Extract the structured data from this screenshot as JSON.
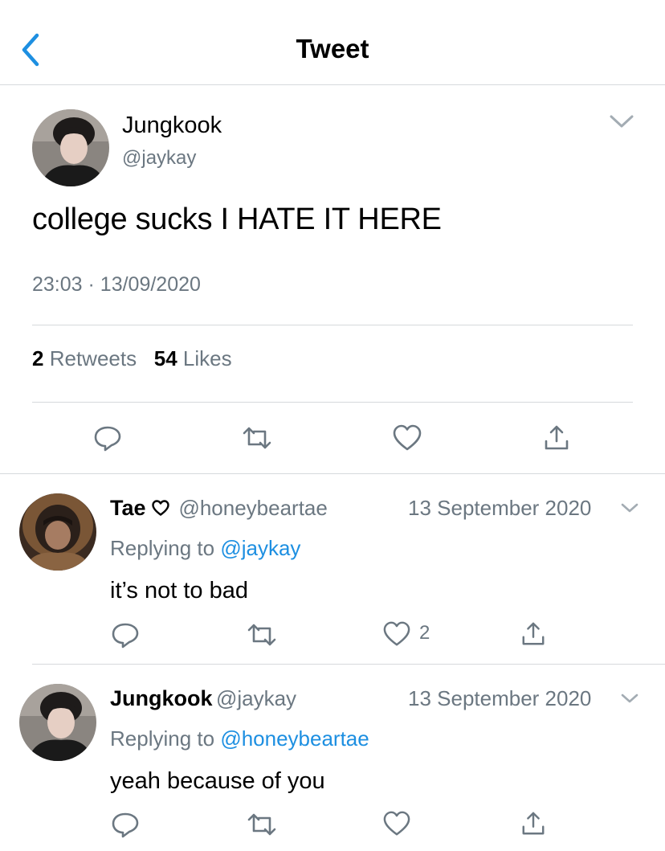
{
  "header": {
    "title": "Tweet",
    "back_icon": "chevron-left-icon"
  },
  "main_tweet": {
    "author_name": "Jungkook",
    "author_handle": "@jaykay",
    "text": "college sucks I HATE IT HERE",
    "time": "23:03",
    "date": "13/09/2020",
    "separator": "·",
    "retweets_count": "2",
    "retweets_label": "Retweets",
    "likes_count": "54",
    "likes_label": "Likes"
  },
  "replies": [
    {
      "author_name": "Tae",
      "author_handle": "@honeybeartae",
      "date": "13 September 2020",
      "replying_label": "Replying to",
      "replying_handle": "@jaykay",
      "text": "it’s not to bad",
      "likes_count": "2"
    },
    {
      "author_name": "Jungkook",
      "author_handle": "@jaykay",
      "date": "13 September 2020",
      "replying_label": "Replying to",
      "replying_handle": "@honeybeartae",
      "text": "yeah because of you"
    }
  ],
  "colors": {
    "accent": "#1d8fe1",
    "muted": "#6b7781",
    "divider": "#d6d9dc"
  },
  "icons": [
    "chevron-left-icon",
    "chevron-down-icon",
    "reply-icon",
    "retweet-icon",
    "heart-icon",
    "share-icon"
  ]
}
